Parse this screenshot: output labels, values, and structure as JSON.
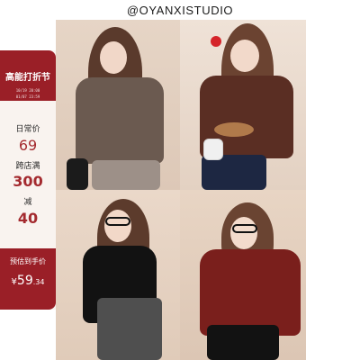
{
  "header": {
    "brand": "@OYANXISTUDIO"
  },
  "sidebar": {
    "promo": {
      "title": "高能打折节",
      "time_line1": "10/19 20:00",
      "time_line2": "01/07 23:59"
    },
    "labels": {
      "daily_price": "日常价",
      "cross_store": "跨店满",
      "reduce": "减"
    },
    "values": {
      "daily_price": "69",
      "threshold": "300",
      "discount": "40"
    },
    "estimate": {
      "label": "预估到手价",
      "currency": "¥",
      "amount": "59",
      "cents": ".34"
    }
  },
  "colors": {
    "accent_red": "#9a1f27",
    "price_red": "#a42a2f",
    "sidebar_bg": "#f9f3ef",
    "photo_bg": "#e3d2c2"
  }
}
